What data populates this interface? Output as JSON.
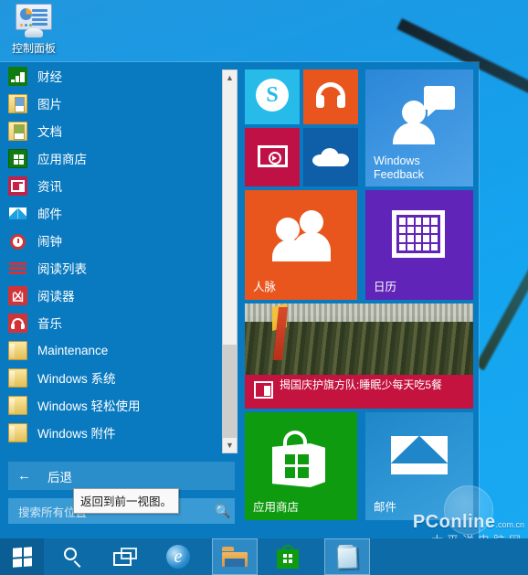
{
  "desktop": {
    "icon": {
      "label": "控制面板",
      "icon": "control-panel-icon"
    },
    "watermark": {
      "main": "PConline",
      "suffix": ".com.cn",
      "chinese": "太平洋电脑网"
    }
  },
  "start_menu": {
    "app_list": [
      {
        "label": "财经",
        "icon": "finance-icon"
      },
      {
        "label": "图片",
        "icon": "pictures-icon"
      },
      {
        "label": "文档",
        "icon": "documents-icon"
      },
      {
        "label": "应用商店",
        "icon": "store-icon"
      },
      {
        "label": "资讯",
        "icon": "news-icon"
      },
      {
        "label": "邮件",
        "icon": "mail-icon"
      },
      {
        "label": "闹钟",
        "icon": "alarm-icon"
      },
      {
        "label": "阅读列表",
        "icon": "reading-list-icon"
      },
      {
        "label": "阅读器",
        "icon": "reader-icon"
      },
      {
        "label": "音乐",
        "icon": "music-icon"
      },
      {
        "label": "Maintenance",
        "icon": "folder-icon"
      },
      {
        "label": "Windows 系统",
        "icon": "folder-icon"
      },
      {
        "label": "Windows 轻松使用",
        "icon": "folder-icon"
      },
      {
        "label": "Windows 附件",
        "icon": "folder-icon"
      }
    ],
    "scrollbar": {
      "up": "▲",
      "down": "▼"
    },
    "back": {
      "label": "后退",
      "arrow": "←"
    },
    "tooltip": {
      "text": "返回到前一视图。"
    },
    "search": {
      "placeholder": "搜索所有位置",
      "icon": "search-icon"
    },
    "tiles": [
      {
        "id": "skype",
        "label": "",
        "icon": "skype-icon",
        "color": "#27bbea"
      },
      {
        "id": "music",
        "label": "",
        "icon": "music-icon",
        "color": "#e8561e"
      },
      {
        "id": "feedback",
        "label": "Windows\nFeedback",
        "icon": "feedback-icon",
        "color": "#2c87d8"
      },
      {
        "id": "video",
        "label": "",
        "icon": "video-icon",
        "color": "#bf1145"
      },
      {
        "id": "onedrive",
        "label": "",
        "icon": "onedrive-icon",
        "color": "#0f5ea8"
      },
      {
        "id": "people",
        "label": "人脉",
        "icon": "people-icon",
        "color": "#e8561e"
      },
      {
        "id": "calendar",
        "label": "日历",
        "icon": "calendar-icon",
        "color": "#6024b8"
      },
      {
        "id": "news",
        "label": "揭国庆护旗方队:睡眠少每天吃5餐",
        "icon": "news-icon",
        "color": "#c4133f"
      },
      {
        "id": "store",
        "label": "应用商店",
        "icon": "store-icon",
        "color": "#0f9b0f"
      },
      {
        "id": "mail",
        "label": "邮件",
        "icon": "mail-icon",
        "color": "#1f87c9"
      }
    ],
    "tile_labels": {
      "feedback_line1": "Windows",
      "feedback_line2": "Feedback",
      "people": "人脉",
      "calendar": "日历",
      "news": "揭国庆护旗方队:睡眠少每天吃5餐",
      "store": "应用商店",
      "mail": "邮件"
    }
  },
  "taskbar": {
    "buttons": [
      {
        "name": "start",
        "icon": "windows-logo-icon"
      },
      {
        "name": "search",
        "icon": "search-icon"
      },
      {
        "name": "taskview",
        "icon": "task-view-icon"
      },
      {
        "name": "ie",
        "icon": "internet-explorer-icon",
        "glyph": "e"
      },
      {
        "name": "explorer",
        "icon": "file-explorer-icon"
      },
      {
        "name": "store",
        "icon": "store-icon"
      },
      {
        "name": "notepad",
        "icon": "notepad-icon"
      }
    ]
  }
}
